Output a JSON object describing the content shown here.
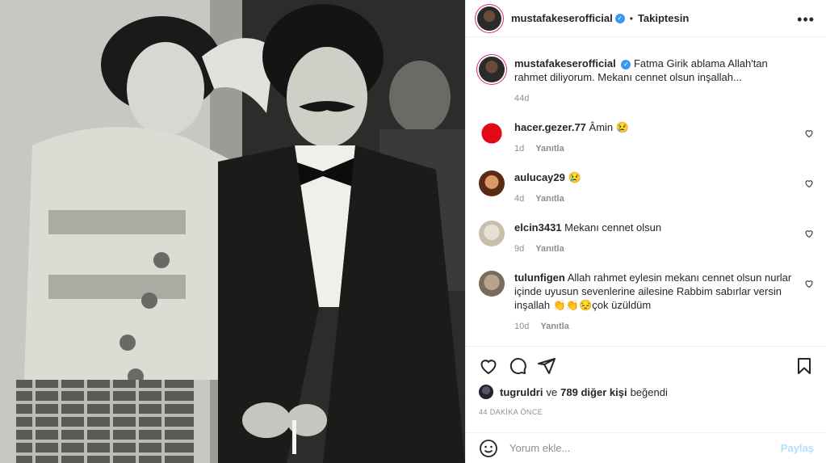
{
  "post": {
    "author": "mustafakeserofficial",
    "follow_status": "Takiptesin",
    "caption": {
      "username": "mustafakeserofficial",
      "text": "Fatma Girik ablama Allah'tan rahmet diliyorum. Mekanı cennet olsun inşallah...",
      "age": "44d"
    },
    "comments": [
      {
        "username": "hacer.gezer.77",
        "text": "Âmin 😢",
        "age": "1d",
        "reply": "Yanıtla"
      },
      {
        "username": "aulucay29",
        "text": "😢",
        "age": "4d",
        "reply": "Yanıtla"
      },
      {
        "username": "elcin3431",
        "text": "Mekanı cennet olsun",
        "age": "9d",
        "reply": "Yanıtla"
      },
      {
        "username": "tulunfigen",
        "text": "Allah rahmet eylesin mekanı cennet olsun nurlar içinde uyusun sevenlerine ailesine Rabbim sabırlar versin inşallah 👏👏😔çok üzüldüm",
        "age": "10d",
        "reply": "Yanıtla"
      }
    ],
    "likes": {
      "first_user": "tugruldri",
      "connector": "ve",
      "others": "789 diğer kişi",
      "suffix": "beğendi"
    },
    "timestamp": "44 DAKİKA ÖNCE",
    "comment_box": {
      "placeholder": "Yorum ekle...",
      "post_label": "Paylaş"
    }
  },
  "icons": {
    "verified": "verified-badge",
    "more": "more-options-icon",
    "like": "heart-icon",
    "comment": "comment-icon",
    "share": "share-icon",
    "save": "bookmark-icon",
    "emoji": "emoji-icon"
  }
}
